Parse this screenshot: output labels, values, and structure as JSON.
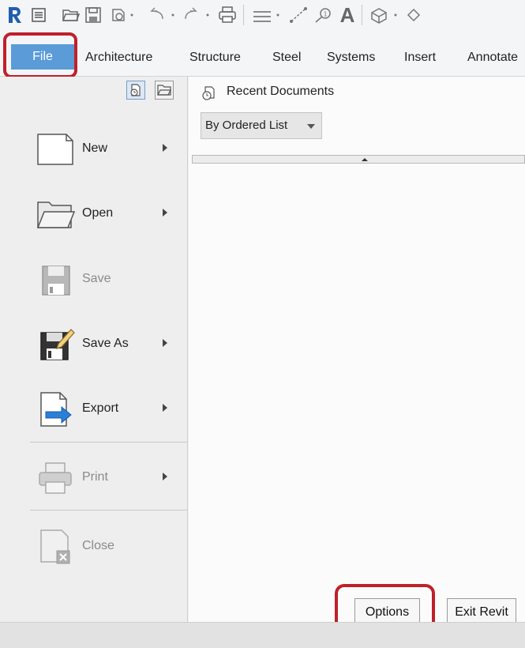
{
  "app": {
    "logo_icon": "revit-logo-icon",
    "accent_color": "#5a9bd8",
    "highlight_color": "#c0202a"
  },
  "quick_access_toolbar": {
    "icons": [
      "revit-logo-icon",
      "properties-icon",
      "open-folder-icon",
      "save-icon",
      "sync-icon",
      "undo-icon",
      "redo-icon",
      "print-icon",
      "align-dimension-icon",
      "measure-icon",
      "tag-icon",
      "text-icon",
      "3d-view-icon",
      "section-icon"
    ],
    "text_icon_glyph": "A"
  },
  "ribbon_tabs": {
    "file": "File",
    "architecture": "Architecture",
    "structure": "Structure",
    "steel": "Steel",
    "systems": "Systems",
    "insert": "Insert",
    "annotate": "Annotate"
  },
  "application_menu": {
    "items": [
      {
        "label": "New",
        "icon": "new-document-icon",
        "enabled": true,
        "submenu": true
      },
      {
        "label": "Open",
        "icon": "open-folder-icon",
        "enabled": true,
        "submenu": true
      },
      {
        "label": "Save",
        "icon": "save-icon",
        "enabled": false,
        "submenu": false
      },
      {
        "label": "Save As",
        "icon": "save-as-icon",
        "enabled": true,
        "submenu": true
      },
      {
        "label": "Export",
        "icon": "export-icon",
        "enabled": true,
        "submenu": true
      },
      {
        "label": "Print",
        "icon": "print-icon",
        "enabled": false,
        "submenu": true
      },
      {
        "label": "Close",
        "icon": "close-document-icon",
        "enabled": false,
        "submenu": false
      }
    ]
  },
  "recent_documents": {
    "title": "Recent Documents",
    "sort_selected": "By Ordered List"
  },
  "footer": {
    "options_label": "Options",
    "exit_label": "Exit Revit"
  }
}
